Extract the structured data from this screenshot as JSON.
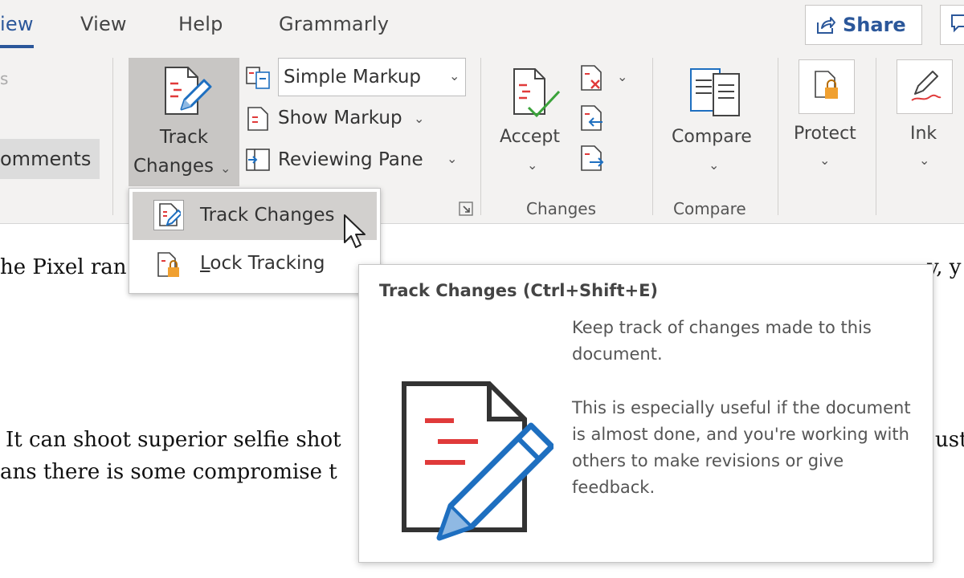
{
  "tabs": [
    {
      "label": "iew",
      "active": true
    },
    {
      "label": "View"
    },
    {
      "label": "Help"
    },
    {
      "label": "Grammarly"
    }
  ],
  "share_label": "Share",
  "ribbon": {
    "faded_letter": "s",
    "comments_label": "omments",
    "track_changes": {
      "line1": "Track",
      "line2": "Changes"
    },
    "markup_select": {
      "value": "Simple Markup"
    },
    "show_markup_label": "Show Markup",
    "reviewing_pane_label": "Reviewing Pane",
    "accept_label": "Accept",
    "compare_label": "Compare",
    "protect_label": "Protect",
    "ink_label": "Ink",
    "groups": {
      "changes": "Changes",
      "compare": "Compare"
    }
  },
  "menu": {
    "items": [
      {
        "label": "Track Changes",
        "highlighted": true
      },
      {
        "label": "Lock Tracking",
        "underline": "L"
      }
    ]
  },
  "document": {
    "line1": "he Pixel ran",
    "line1_right": "y, y",
    "line2": "It can shoot superior selfie shot",
    "line2_right": "ust",
    "line3": "ans there is some compromise t"
  },
  "tooltip": {
    "title": "Track Changes (Ctrl+Shift+E)",
    "para1": "Keep track of changes made to this document.",
    "para2": "This is especially useful if the document is almost done, and you're working with others to make revisions or give feedback."
  },
  "colors": {
    "accent": "#2b579a",
    "red_marks": "#e03a3a",
    "pencil_blue": "#1e6fc0",
    "link_blue": "#2f2fe0"
  }
}
